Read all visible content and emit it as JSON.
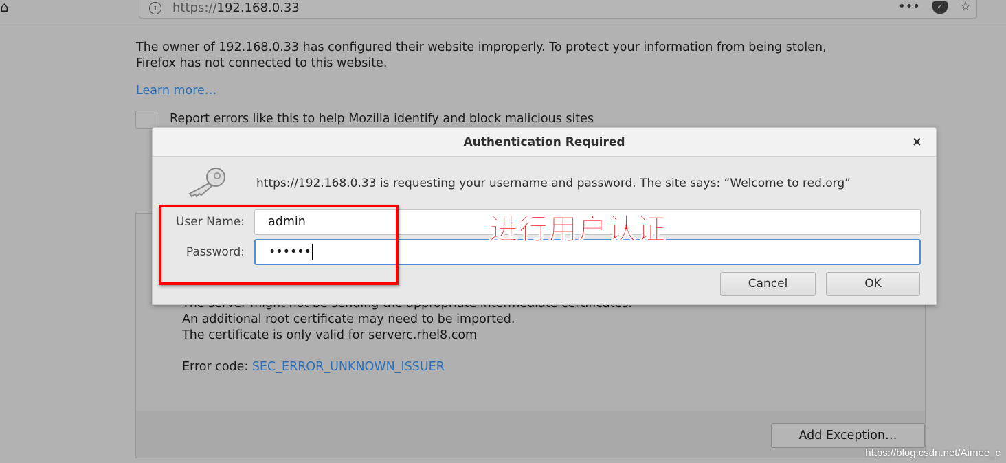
{
  "browser": {
    "url_prefix": "https://",
    "url_host": "192.168.0.33",
    "menu_icon": "•••",
    "icons": [
      "home-icon",
      "info-icon",
      "more-icon",
      "pocket-icon",
      "star-icon"
    ]
  },
  "page": {
    "intro": "The owner of 192.168.0.33 has configured their website improperly. To protect your information from being stolen, Firefox has not connected to this website.",
    "intro_line1": "The owner of 192.168.0.33 has configured their website improperly. To protect your information from being stolen,",
    "intro_line2": "Firefox has not connected to this website.",
    "learn_more": "Learn more…",
    "report_label": "Report errors like this to help Mozilla identify and block malicious sites",
    "details": [
      "The server might not be sending the appropriate intermediate certificates.",
      "An additional root certificate may need to be imported.",
      "The certificate is only valid for serverc.rhel8.com"
    ],
    "error_code_label": "Error code: ",
    "error_code": "SEC_ERROR_UNKNOWN_ISSUER",
    "add_exception": "Add Exception…"
  },
  "dialog": {
    "title": "Authentication Required",
    "close": "×",
    "message": "https://192.168.0.33 is requesting your username and password. The site says: “Welcome to red.org”",
    "username_label": "User Name:",
    "username_value": "admin",
    "password_label": "Password:",
    "password_value": "••••••",
    "cancel": "Cancel",
    "ok": "OK"
  },
  "annotation": {
    "text": "进行用户认证",
    "color": "#ff0000"
  },
  "watermark": "https://blog.csdn.net/Aimee_c"
}
